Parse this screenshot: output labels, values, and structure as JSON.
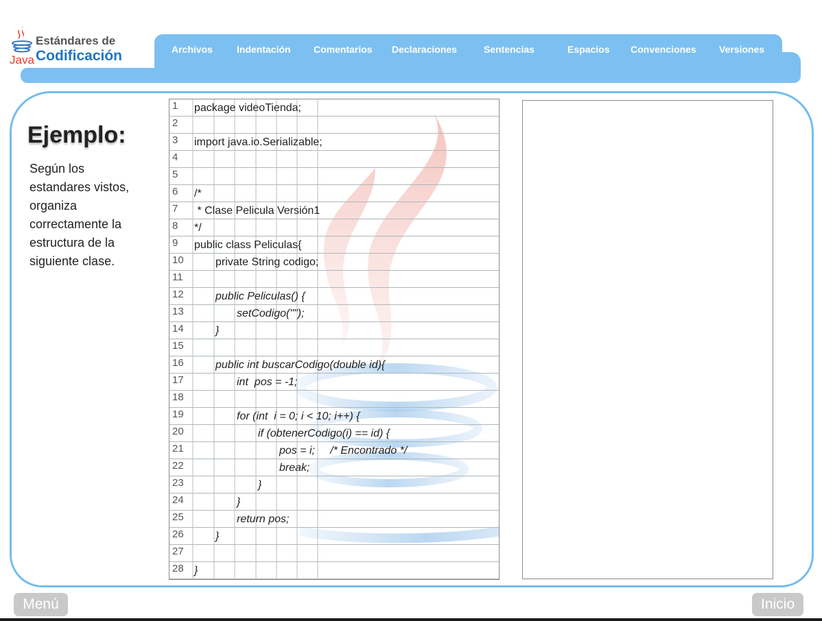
{
  "logo": {
    "title_line1": "Estándares de",
    "title_line2": "Codificación",
    "java_word": "Java"
  },
  "nav": {
    "items": [
      "Archivos",
      "Indentación",
      "Comentarios",
      "Declaraciones",
      "Sentencias",
      "Espacios",
      "Convenciones",
      "Versiones"
    ]
  },
  "main": {
    "heading": "Ejemplo:",
    "description": "Según los estandares vistos, organiza correctamente la estructura de la siguiente clase."
  },
  "code_lines": [
    {
      "n": "1",
      "text": "package videoTienda;",
      "indent": 0,
      "italic": false
    },
    {
      "n": "2",
      "text": "",
      "indent": 0,
      "italic": false
    },
    {
      "n": "3",
      "text": "import java.io.Serializable;",
      "indent": 0,
      "italic": false
    },
    {
      "n": "4",
      "text": "",
      "indent": 0,
      "italic": false
    },
    {
      "n": "5",
      "text": "",
      "indent": 0,
      "italic": false
    },
    {
      "n": "6",
      "text": "/*",
      "indent": 0,
      "italic": false
    },
    {
      "n": "7",
      "text": " * Clase Pelicula Versión1",
      "indent": 0,
      "italic": false
    },
    {
      "n": "8",
      "text": "*/",
      "indent": 0,
      "italic": false
    },
    {
      "n": "9",
      "text": "public class Peliculas{",
      "indent": 0,
      "italic": false
    },
    {
      "n": "10",
      "text": "private String codigo;",
      "indent": 1,
      "italic": false
    },
    {
      "n": "11",
      "text": "",
      "indent": 0,
      "italic": false
    },
    {
      "n": "12",
      "text": "public Peliculas() {",
      "indent": 1,
      "italic": true
    },
    {
      "n": "13",
      "text": "setCodigo(\"\");",
      "indent": 2,
      "italic": true
    },
    {
      "n": "14",
      "text": "}",
      "indent": 1,
      "italic": true
    },
    {
      "n": "15",
      "text": "",
      "indent": 0,
      "italic": false
    },
    {
      "n": "16",
      "text": "public int buscarCodigo(double id){",
      "indent": 1,
      "italic": true
    },
    {
      "n": "17",
      "text": "int  pos = -1;",
      "indent": 2,
      "italic": true
    },
    {
      "n": "18",
      "text": "",
      "indent": 0,
      "italic": false
    },
    {
      "n": "19",
      "text": "for (int  i = 0; i < 10; i++) {",
      "indent": 2,
      "italic": true
    },
    {
      "n": "20",
      "text": "if (obtenerCodigo(i) == id) {",
      "indent": 3,
      "italic": true
    },
    {
      "n": "21",
      "text": "pos = i;     /* Encontrado */",
      "indent": 4,
      "italic": true
    },
    {
      "n": "22",
      "text": "break;",
      "indent": 4,
      "italic": true
    },
    {
      "n": "23",
      "text": "}",
      "indent": 3,
      "italic": true
    },
    {
      "n": "24",
      "text": "}",
      "indent": 2,
      "italic": true
    },
    {
      "n": "25",
      "text": "return pos;",
      "indent": 2,
      "italic": true
    },
    {
      "n": "26",
      "text": "}",
      "indent": 1,
      "italic": true
    },
    {
      "n": "27",
      "text": "",
      "indent": 0,
      "italic": false
    },
    {
      "n": "28",
      "text": "}",
      "indent": 0,
      "italic": true
    }
  ],
  "footer": {
    "menu_label": "Menú",
    "home_label": "Inicio"
  },
  "colors": {
    "accent_blue": "#7cc0f1",
    "frame_blue": "#74bcec",
    "title_blue": "#1f76c4",
    "java_red": "#e0412a",
    "button_gray": "#c9c9c9"
  }
}
